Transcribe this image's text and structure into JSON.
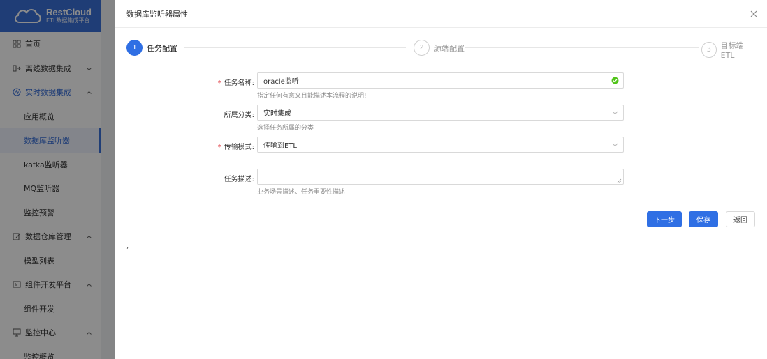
{
  "brand": {
    "title": "RestCloud",
    "subtitle": "ETL数据集成平台"
  },
  "sidebar": {
    "items": [
      {
        "label": "首页",
        "icon": "grid-icon",
        "kind": "top"
      },
      {
        "label": "离线数据集成",
        "icon": "data-flow-icon",
        "kind": "top",
        "chevron": "down"
      },
      {
        "label": "实时数据集成",
        "icon": "realtime-icon",
        "kind": "top-open",
        "chevron": "up"
      },
      {
        "label": "应用概览",
        "kind": "sub"
      },
      {
        "label": "数据库监听器",
        "kind": "sub-active"
      },
      {
        "label": "kafka监听器",
        "kind": "sub"
      },
      {
        "label": "MQ监听器",
        "kind": "sub"
      },
      {
        "label": "监控预警",
        "kind": "sub"
      },
      {
        "label": "数据仓库管理",
        "icon": "edit-icon",
        "kind": "top",
        "chevron": "up"
      },
      {
        "label": "模型列表",
        "kind": "sub"
      },
      {
        "label": "组件开发平台",
        "icon": "component-icon",
        "kind": "top",
        "chevron": "up"
      },
      {
        "label": "组件开发",
        "kind": "sub"
      },
      {
        "label": "监控中心",
        "icon": "monitor-icon",
        "kind": "top",
        "chevron": "up"
      },
      {
        "label": "监控概览",
        "kind": "sub"
      }
    ]
  },
  "drawer": {
    "title": "数据库监听器属性",
    "steps": [
      {
        "num": "1",
        "label": "任务配置",
        "status": "active"
      },
      {
        "num": "2",
        "label": "源端配置",
        "status": "wait"
      },
      {
        "num": "3",
        "label": "目标端ETL",
        "status": "wait"
      }
    ],
    "form": {
      "name": {
        "label": "任务名称:",
        "value": "oracle监听",
        "hint": "指定任何有意义且能描述本流程的说明!"
      },
      "category": {
        "label": "所属分类:",
        "value": "实时集成",
        "hint": "选择任务所属的分类"
      },
      "mode": {
        "label": "传输模式:",
        "value": "传输到ETL"
      },
      "desc": {
        "label": "任务描述:",
        "value": "",
        "hint": "业务场景描述、任务重要性描述"
      }
    },
    "buttons": {
      "next": "下一步",
      "save": "保存",
      "back": "返回"
    },
    "stray": ","
  },
  "colors": {
    "primary": "#2f6fe4",
    "required": "#e0383e",
    "success": "#52c41a"
  }
}
